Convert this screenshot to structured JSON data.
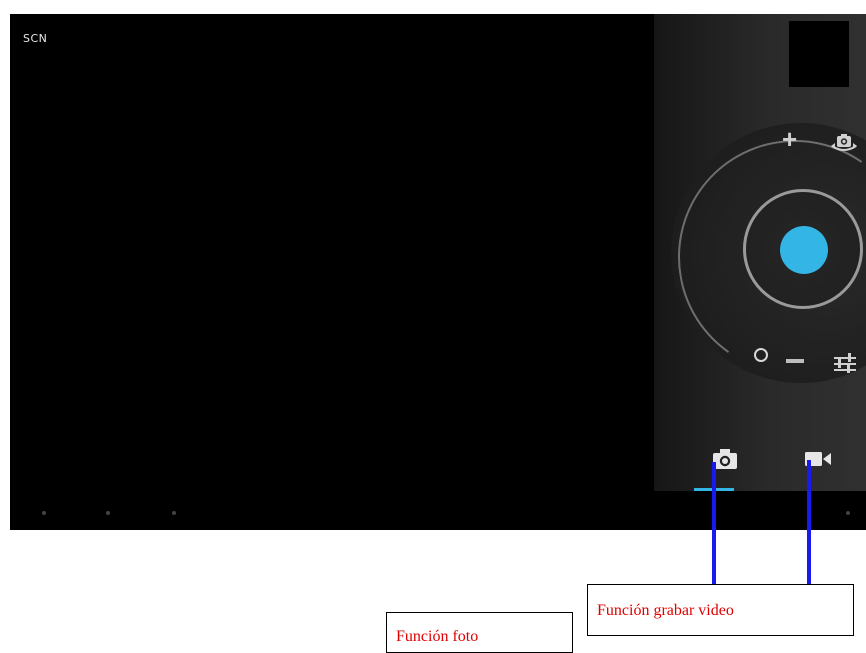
{
  "camera": {
    "scene_mode_label": "SCN",
    "icons": {
      "switch_camera": "camera-switch-icon",
      "settings": "sliders-icon",
      "photo_mode": "camera-icon",
      "video_mode": "video-camera-icon"
    },
    "zoom": {
      "plus_label": "+"
    }
  },
  "annotations": {
    "photo_label": "Función foto",
    "video_label": "Función grabar video"
  },
  "colors": {
    "shutter_accent": "#33b5e5",
    "callout_line": "#1a1aee",
    "label_text": "#e00000",
    "mode_indicator": "#33b5e5"
  }
}
